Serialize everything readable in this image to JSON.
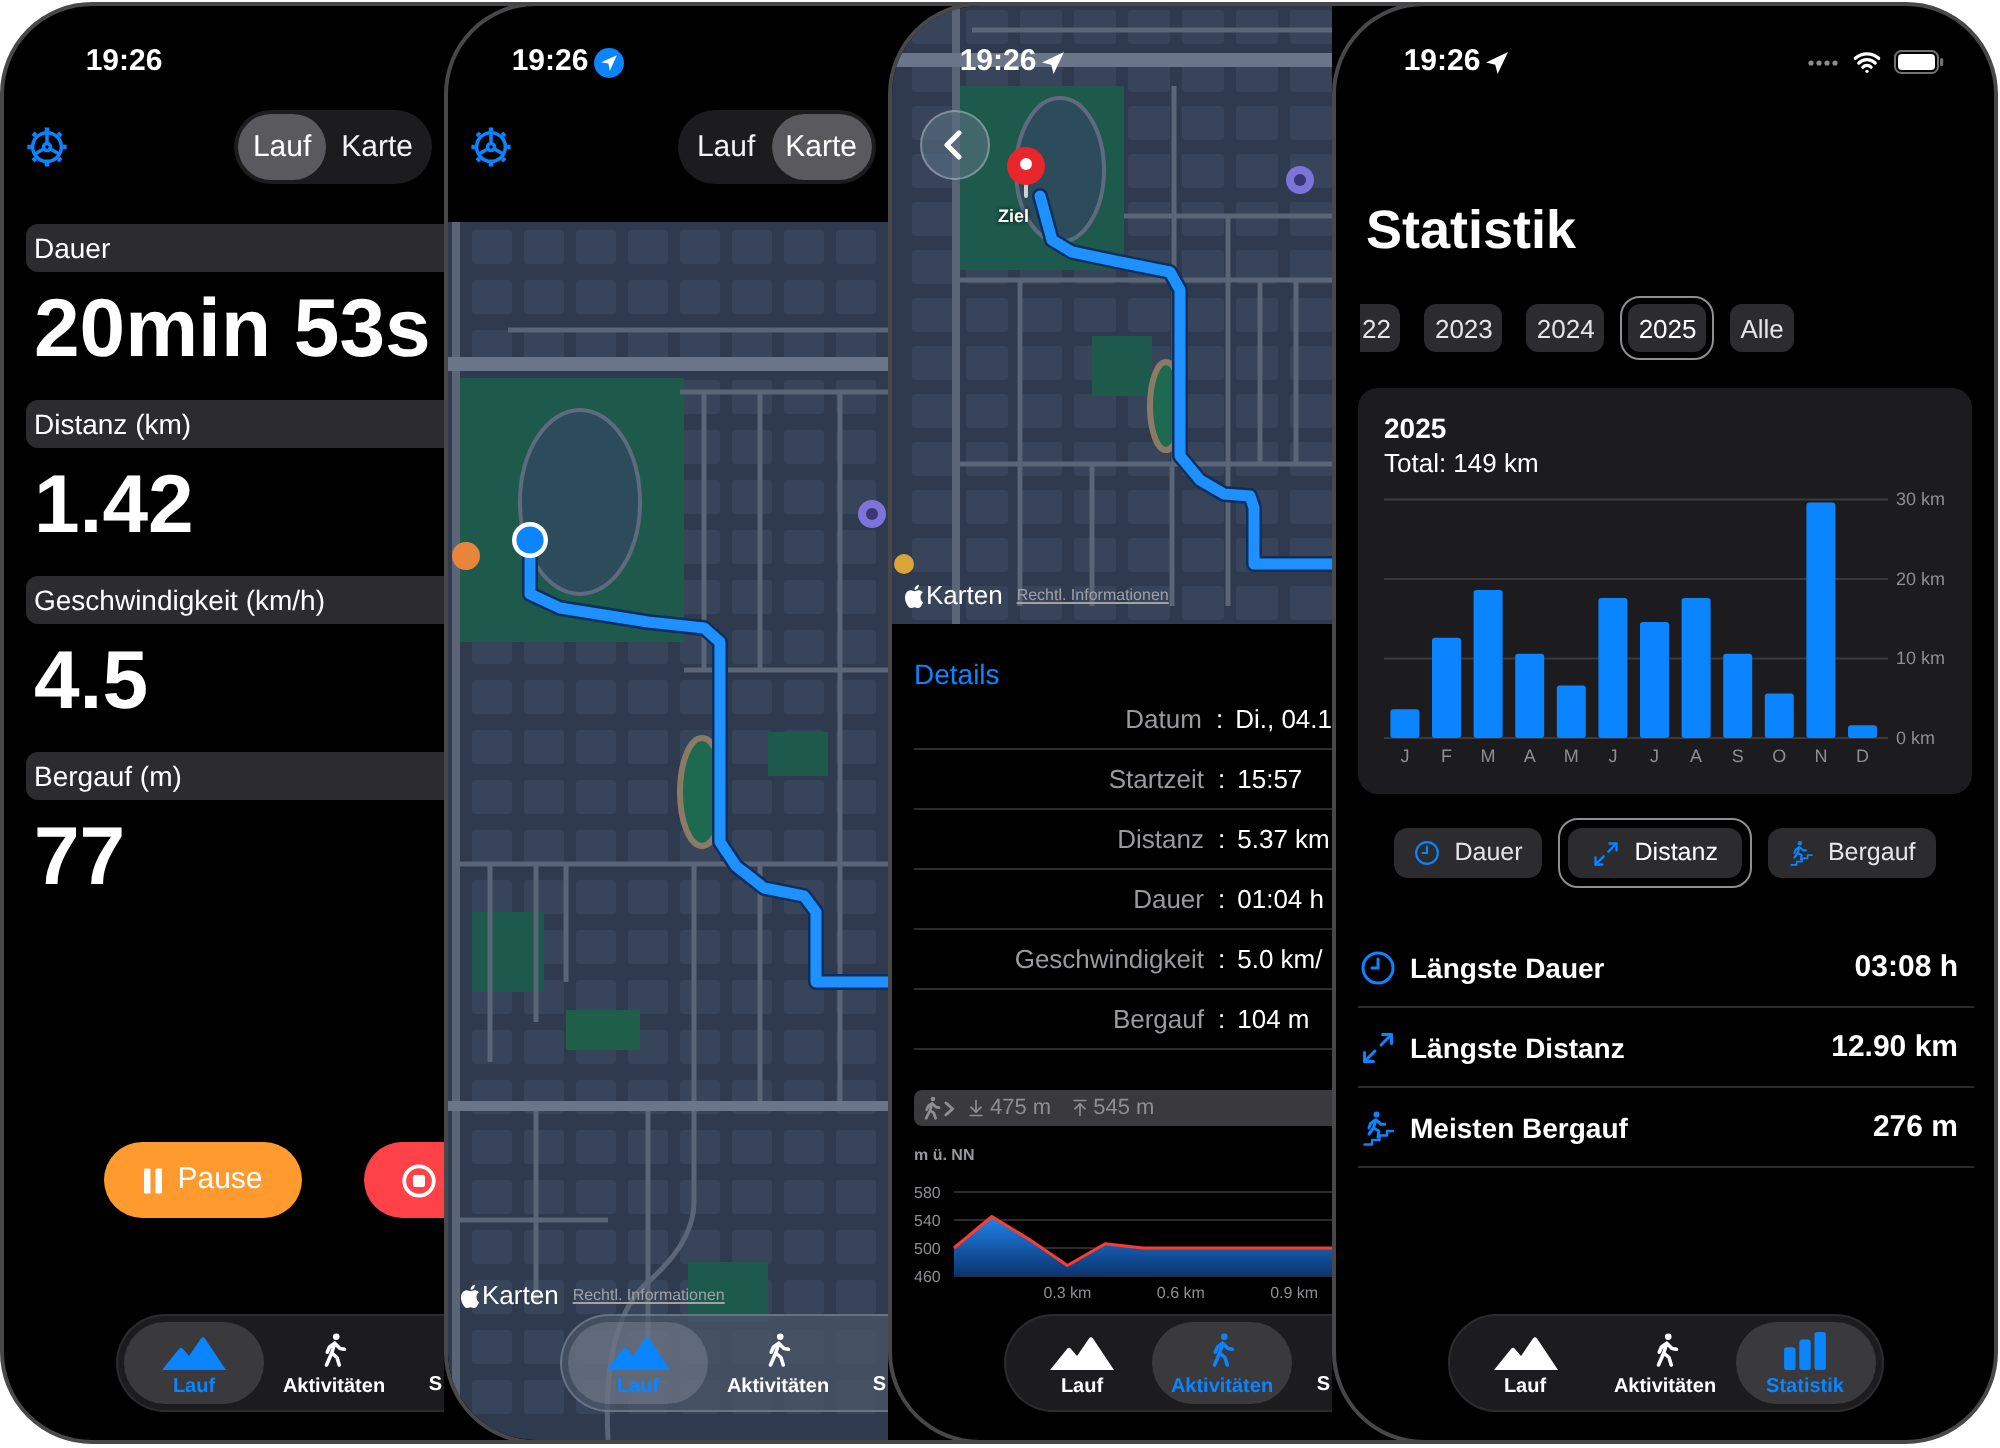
{
  "phones": [
    {
      "kind": "run",
      "status_bar": {
        "time": "19:26",
        "location_arrow": false
      },
      "view_toggle": [
        {
          "label": "Lauf",
          "selected": true
        },
        {
          "label": "Karte",
          "selected": false
        }
      ],
      "metrics": [
        {
          "label": "Dauer",
          "value": "20min 53s"
        },
        {
          "label": "Distanz (km)",
          "value": "1.42"
        },
        {
          "label": "Geschwindigkeit (km/h)",
          "value": "4.5"
        },
        {
          "label": "Bergauf (m)",
          "value": "77"
        }
      ],
      "pause_button": {
        "label": "Pause"
      },
      "tabs": [
        {
          "label": "Lauf",
          "selected": true,
          "partial": false
        },
        {
          "label": "Aktivitäten",
          "selected": false,
          "partial": false
        },
        {
          "label": "S",
          "selected": false,
          "partial": true
        }
      ]
    },
    {
      "kind": "map",
      "status_bar": {
        "time": "19:26",
        "location_arrow": true,
        "location_filled": true
      },
      "view_toggle": [
        {
          "label": "Lauf",
          "selected": false
        },
        {
          "label": "Karte",
          "selected": true
        }
      ],
      "map": {
        "attribution": "Karten",
        "legal_link": "Rechtl. Informationen"
      },
      "tabs": [
        {
          "label": "Lauf",
          "selected": true,
          "partial": false
        },
        {
          "label": "Aktivitäten",
          "selected": false,
          "partial": false
        },
        {
          "label": "S",
          "selected": false,
          "partial": true
        }
      ]
    },
    {
      "kind": "details",
      "status_bar": {
        "time": "19:26",
        "location_arrow": true,
        "location_filled": false
      },
      "map": {
        "pin_label": "Ziel",
        "attribution": "Karten",
        "legal_link": "Rechtl. Informationen"
      },
      "section_title": "Details",
      "details": [
        {
          "label": "Datum",
          "separator": ":",
          "value": "Di., 04.1"
        },
        {
          "label": "Startzeit",
          "separator": ":",
          "value": "15:57"
        },
        {
          "label": "Distanz",
          "separator": ":",
          "value": "5.37 km"
        },
        {
          "label": "Dauer",
          "separator": ":",
          "value": "01:04 h"
        },
        {
          "label": "Geschwindigkeit",
          "separator": ":",
          "value": "5.0 km/"
        },
        {
          "label": "Bergauf",
          "separator": ":",
          "value": "104 m"
        }
      ],
      "elevation_summary": {
        "lowest": "475 m",
        "highest": "545 m"
      },
      "elevation_profile": {
        "chart_data": {
          "type": "area",
          "ylabel": "m ü. NN",
          "x": [
            0,
            0.1,
            0.2,
            0.3,
            0.4,
            0.5,
            0.6,
            0.7,
            0.8,
            0.9,
            1
          ],
          "values": [
            500,
            545,
            512,
            475,
            506,
            500,
            500,
            500,
            500,
            500,
            500
          ],
          "xlim": [
            0,
            1
          ],
          "ylim": [
            460,
            580
          ],
          "xticks": [
            {
              "value": 0.3,
              "label": "0.3 km"
            },
            {
              "value": 0.6,
              "label": "0.6 km"
            },
            {
              "value": 0.9,
              "label": "0.9 km"
            }
          ],
          "yticks": [
            460,
            500,
            540,
            580
          ]
        }
      },
      "tabs": [
        {
          "label": "Lauf",
          "selected": false,
          "partial": false
        },
        {
          "label": "Aktivitäten",
          "selected": true,
          "partial": false
        },
        {
          "label": "S",
          "selected": false,
          "partial": true
        }
      ]
    },
    {
      "kind": "stats",
      "status_bar": {
        "time": "19:26",
        "location_arrow": true,
        "location_filled": false
      },
      "title": "Statistik",
      "years": [
        {
          "label": "22",
          "selected": false,
          "partial": true
        },
        {
          "label": "2023",
          "selected": false,
          "partial": false
        },
        {
          "label": "2024",
          "selected": false,
          "partial": false
        },
        {
          "label": "2025",
          "selected": true,
          "partial": false
        },
        {
          "label": "Alle",
          "selected": false,
          "partial": false
        }
      ],
      "summary": {
        "title": "2025",
        "total": "Total: 149 km",
        "chart_data": {
          "type": "bar",
          "categories": [
            "J",
            "F",
            "M",
            "A",
            "M",
            "J",
            "J",
            "A",
            "S",
            "O",
            "N",
            "D"
          ],
          "values": [
            3.6,
            12.6,
            18.6,
            10.6,
            6.6,
            17.6,
            14.6,
            17.6,
            10.6,
            5.6,
            29.6,
            1.6
          ],
          "ylim": [
            0,
            30
          ],
          "yticks": [
            {
              "value": 0,
              "label": "0 km"
            },
            {
              "value": 10,
              "label": "10 km"
            },
            {
              "value": 20,
              "label": "20 km"
            },
            {
              "value": 30,
              "label": "30 km"
            }
          ]
        }
      },
      "metric_buttons": [
        {
          "label": "Dauer",
          "selected": false
        },
        {
          "label": "Distanz",
          "selected": true
        },
        {
          "label": "Bergauf",
          "selected": false
        }
      ],
      "records": [
        {
          "label": "Längste Dauer",
          "value": "03:08 h"
        },
        {
          "label": "Längste Distanz",
          "value": "12.90 km"
        },
        {
          "label": "Meisten Bergauf",
          "value": "276 m"
        }
      ],
      "tabs": [
        {
          "label": "Lauf",
          "selected": false,
          "partial": false
        },
        {
          "label": "Aktivitäten",
          "selected": false,
          "partial": false
        },
        {
          "label": "Statistik",
          "selected": true,
          "partial": false
        }
      ]
    }
  ]
}
